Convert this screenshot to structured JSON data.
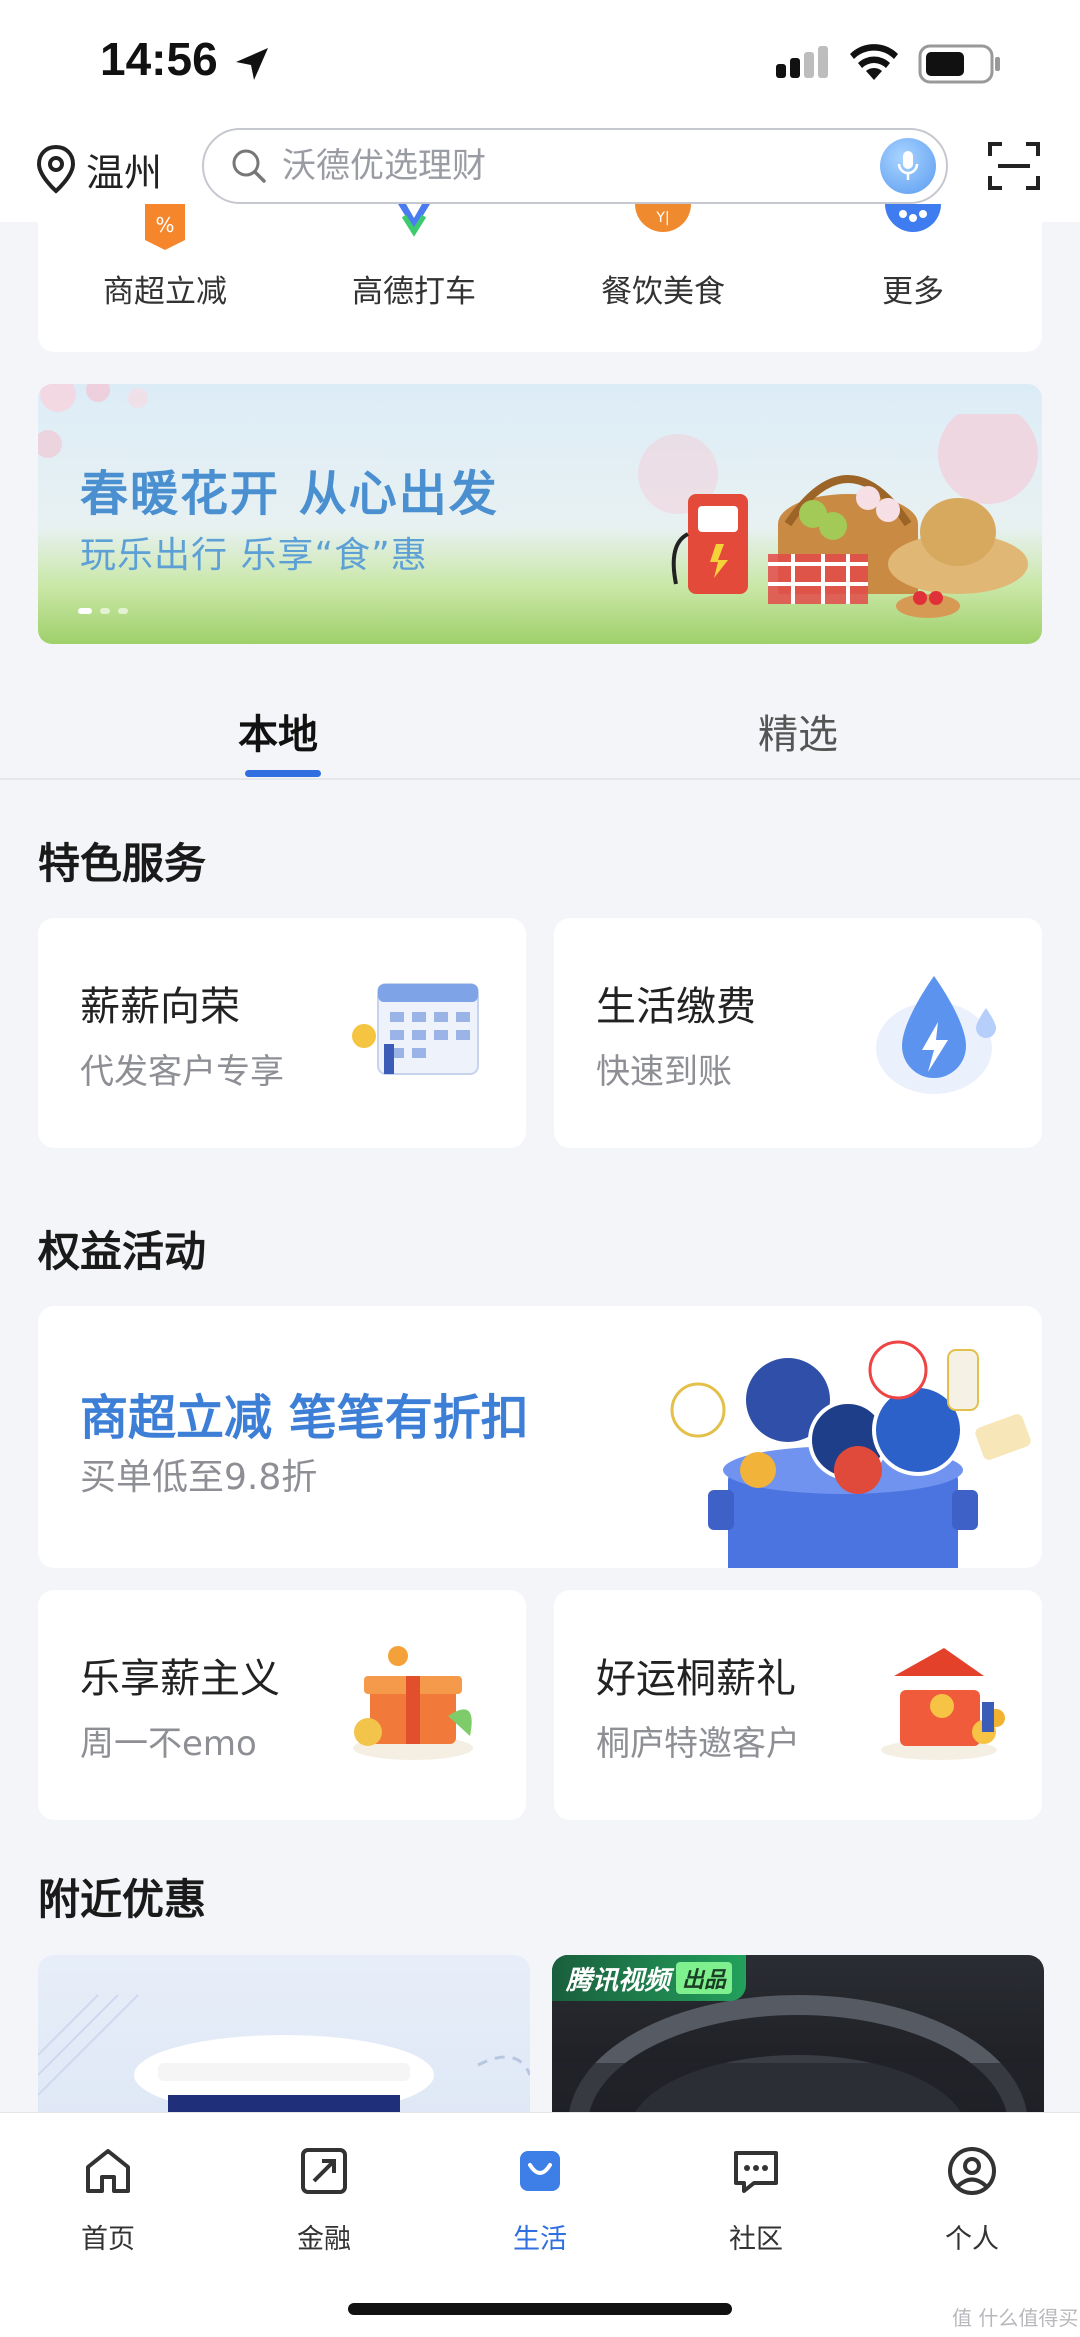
{
  "status_bar": {
    "time": "14:56"
  },
  "header": {
    "city": "温州",
    "search_placeholder": "沃德优选理财"
  },
  "quick_services": [
    {
      "label": "商超立减",
      "icon": "discount-tag-icon",
      "color": "#f5862c"
    },
    {
      "label": "高德打车",
      "icon": "amap-icon",
      "color": "#4a7bf0"
    },
    {
      "label": "餐饮美食",
      "icon": "food-icon",
      "color": "#f08a2e"
    },
    {
      "label": "更多",
      "icon": "more-icon",
      "color": "#3f7cf0"
    }
  ],
  "banner": {
    "title": "春暖花开 从心出发",
    "subtitle": "玩乐出行 乐享“食”惠"
  },
  "tabs": [
    {
      "label": "本地",
      "active": true
    },
    {
      "label": "精选",
      "active": false
    }
  ],
  "featured_services": {
    "title": "特色服务",
    "items": [
      {
        "title": "薪薪向荣",
        "subtitle": "代发客户专享",
        "icon": "calendar-illustration-icon"
      },
      {
        "title": "生活缴费",
        "subtitle": "快速到账",
        "icon": "water-drop-bolt-icon"
      }
    ]
  },
  "rights_activities": {
    "title": "权益活动",
    "promo": {
      "title": "商超立减 笔笔有折扣",
      "subtitle": "买单低至9.8折"
    },
    "items": [
      {
        "title": "乐享薪主义",
        "subtitle": "周一不emo",
        "icon": "gift-box-illustration-icon"
      },
      {
        "title": "好运桐薪礼",
        "subtitle": "桐庐特邀客户",
        "icon": "red-envelope-coins-icon"
      }
    ]
  },
  "nearby": {
    "title": "附近优惠",
    "tv_brand": "腾讯视频",
    "tv_badge": "出品"
  },
  "tabbar": [
    {
      "label": "首页",
      "icon": "home-icon",
      "active": false
    },
    {
      "label": "金融",
      "icon": "finance-icon",
      "active": false
    },
    {
      "label": "生活",
      "icon": "shopping-bag-icon",
      "active": true
    },
    {
      "label": "社区",
      "icon": "chat-icon",
      "active": false
    },
    {
      "label": "个人",
      "icon": "user-icon",
      "active": false
    }
  ],
  "watermark": "值 什么值得买",
  "colors": {
    "accent": "#2f6fe0",
    "promo_text": "#3d7fd6",
    "background": "#f4f5f9"
  }
}
